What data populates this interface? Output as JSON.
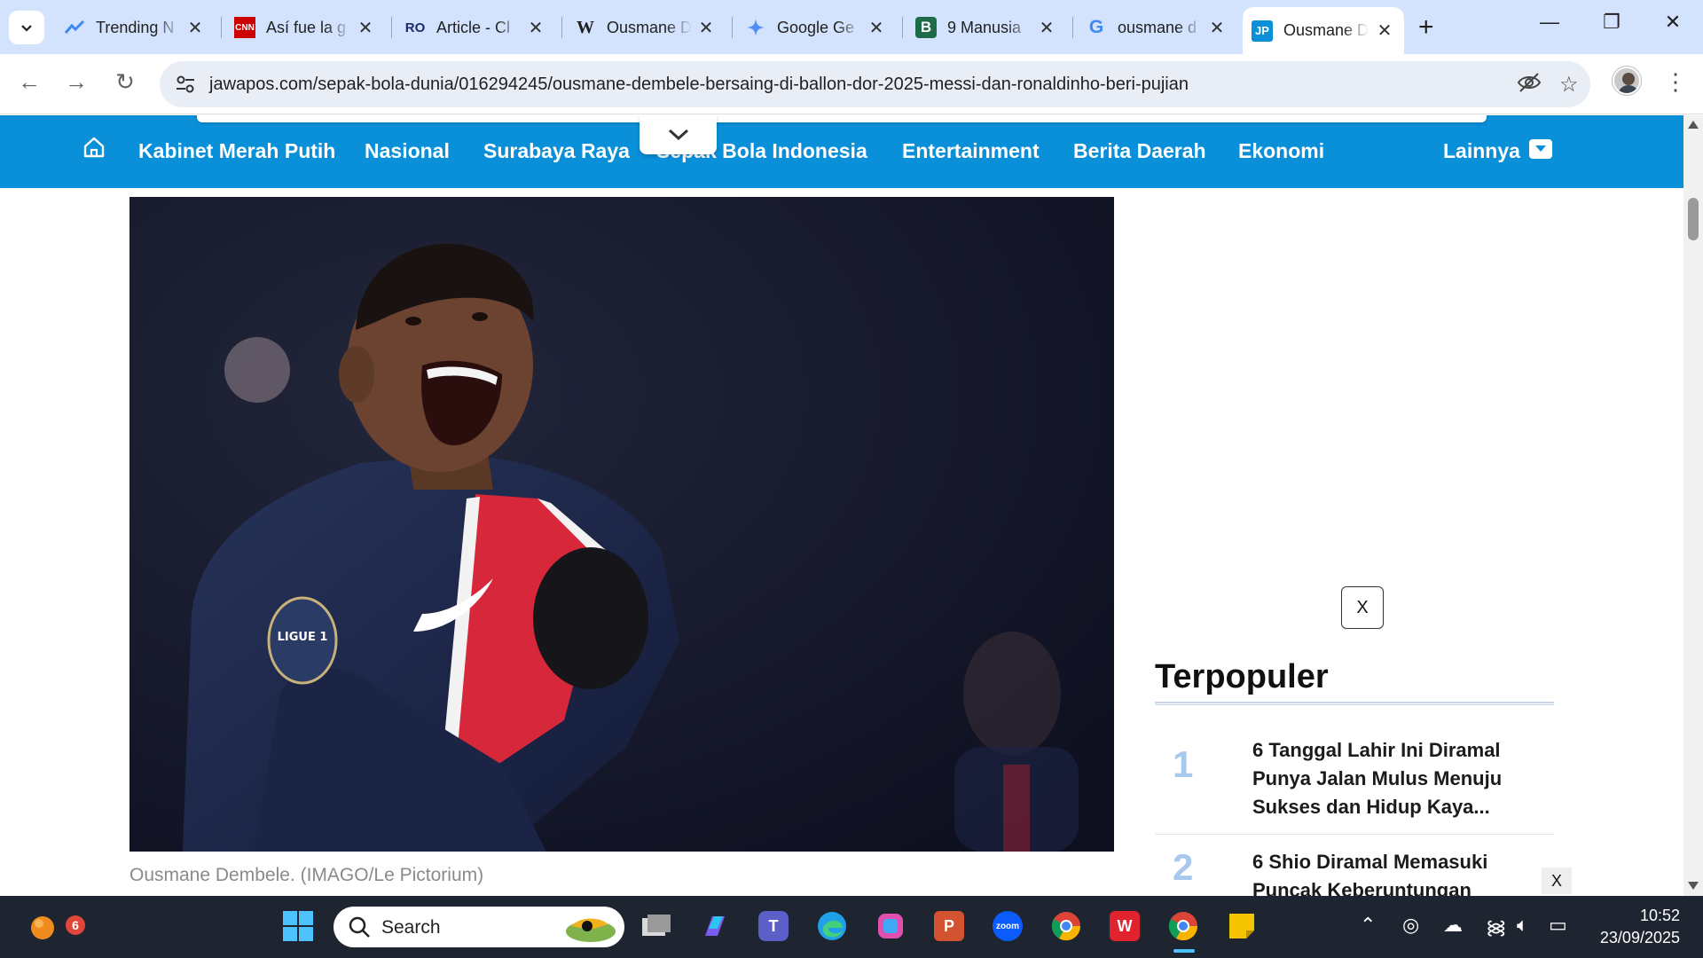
{
  "browser": {
    "tabs": [
      {
        "title": "Trending N",
        "favicon": "trending-icon",
        "active": false
      },
      {
        "title": "Así fue la g",
        "favicon": "cnn-icon",
        "active": false
      },
      {
        "title": "Article - Cl",
        "favicon": "ro-icon",
        "active": false
      },
      {
        "title": "Ousmane D",
        "favicon": "wikipedia-icon",
        "active": false
      },
      {
        "title": "Google Ge",
        "favicon": "gemini-icon",
        "active": false
      },
      {
        "title": "9 Manusia",
        "favicon": "b-icon",
        "active": false
      },
      {
        "title": "ousmane d",
        "favicon": "google-icon",
        "active": false
      },
      {
        "title": "Ousmane D",
        "favicon": "jp-icon",
        "active": true
      }
    ],
    "url": "jawapos.com/sepak-bola-dunia/016294245/ousmane-dembele-bersaing-di-ballon-dor-2025-messi-dan-ronaldinho-beri-pujian"
  },
  "site": {
    "nav": [
      "Kabinet Merah Putih",
      "Nasional",
      "Surabaya Raya",
      "Sepak Bola Indonesia",
      "Entertainment",
      "Berita Daerah",
      "Ekonomi"
    ],
    "more_label": "Lainnya",
    "brand_color": "#0a8fd9"
  },
  "article": {
    "image_caption": "Ousmane Dembele. (IMAGO/Le Pictorium)"
  },
  "sidebar": {
    "ad_close_label": "X",
    "popular_title": "Terpopuler",
    "popular": [
      {
        "rank": "1",
        "title": "6 Tanggal Lahir Ini Diramal Punya Jalan Mulus Menuju Sukses dan Hidup Kaya..."
      },
      {
        "rank": "2",
        "title": "6 Shio Diramal Memasuki Puncak Keberuntungan"
      }
    ],
    "small_close_label": "X"
  },
  "taskbar": {
    "search_label": "Search",
    "notification_count": "6",
    "time": "10:52",
    "date": "23/09/2025"
  }
}
